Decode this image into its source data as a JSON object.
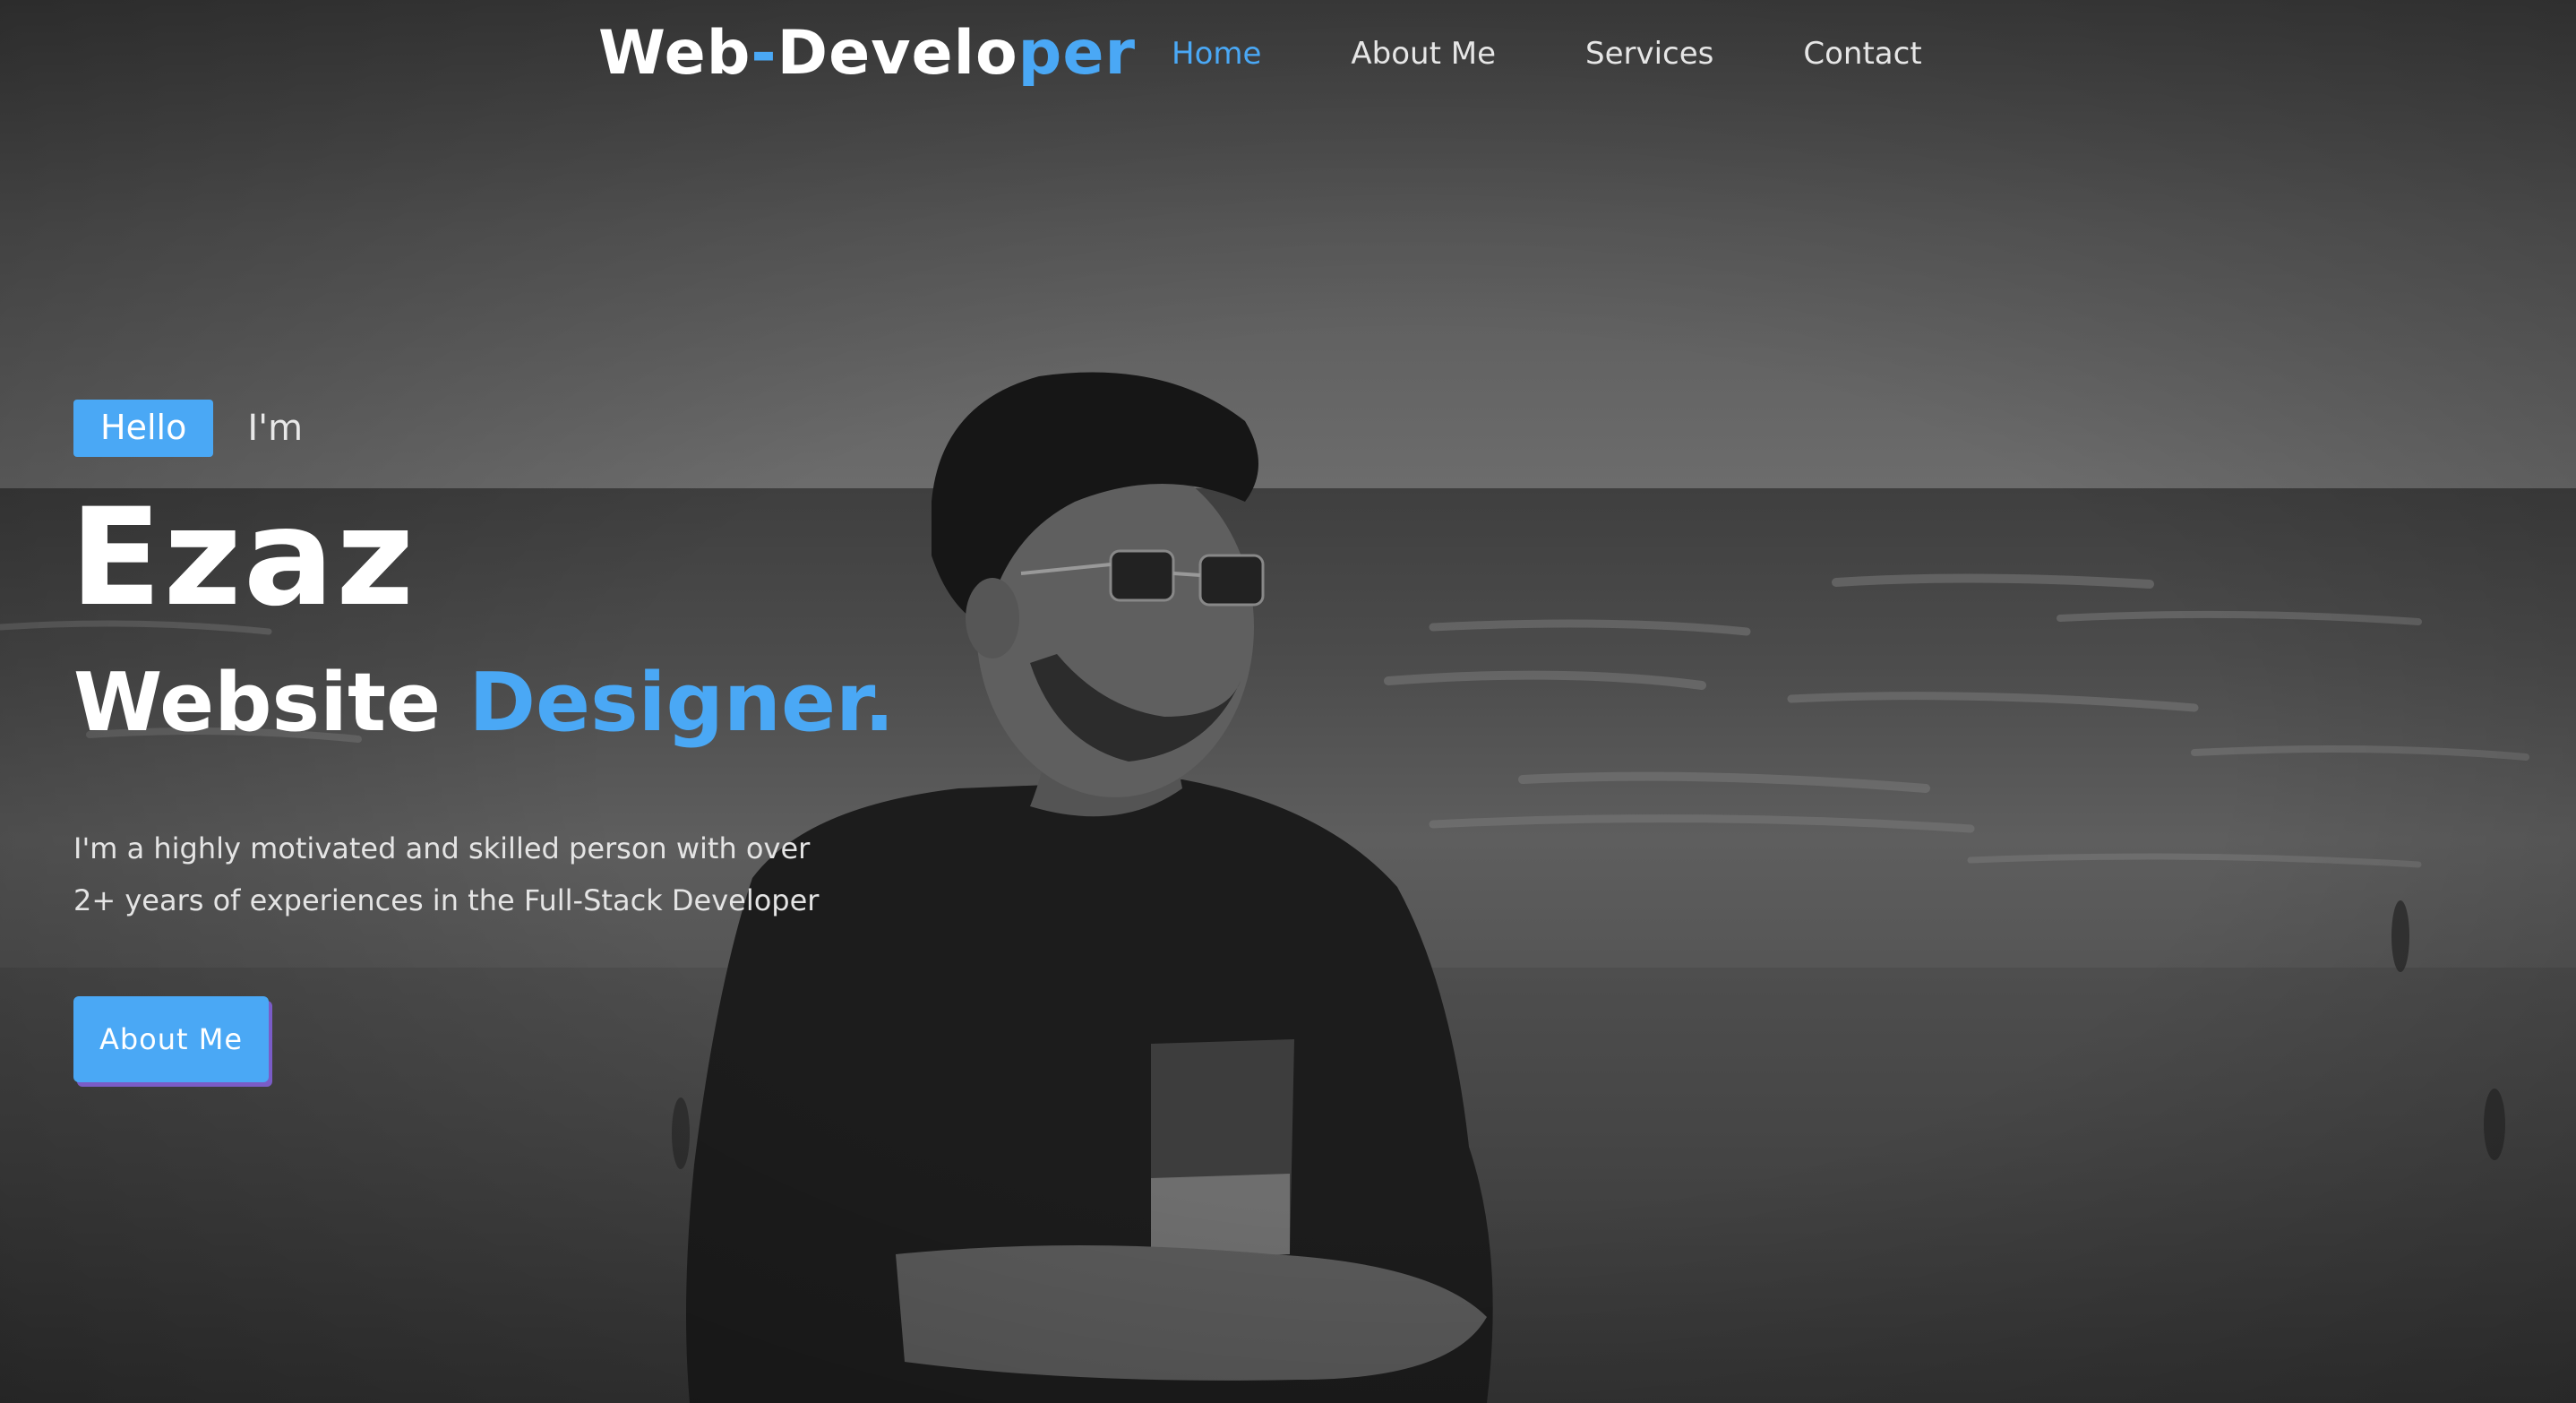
{
  "nav": {
    "logo_part1": "Web",
    "logo_dash": "-",
    "logo_part2": "Develo",
    "logo_part3": "per",
    "links": [
      {
        "label": "Home",
        "active": true
      },
      {
        "label": "About Me",
        "active": false
      },
      {
        "label": "Services",
        "active": false
      },
      {
        "label": "Contact",
        "active": false
      }
    ]
  },
  "hero": {
    "hello_badge": "Hello",
    "im": "I'm",
    "name": "Ezaz",
    "role_plain": "Website ",
    "role_accent": "Designer.",
    "description_line1": "I'm a highly motivated and skilled person with over",
    "description_line2": "2+ years of experiences in the Full-Stack Developer",
    "cta_label": "About Me"
  },
  "colors": {
    "accent": "#4aa8f5",
    "button_shadow": "#7a5cc7",
    "text": "#ffffff"
  }
}
